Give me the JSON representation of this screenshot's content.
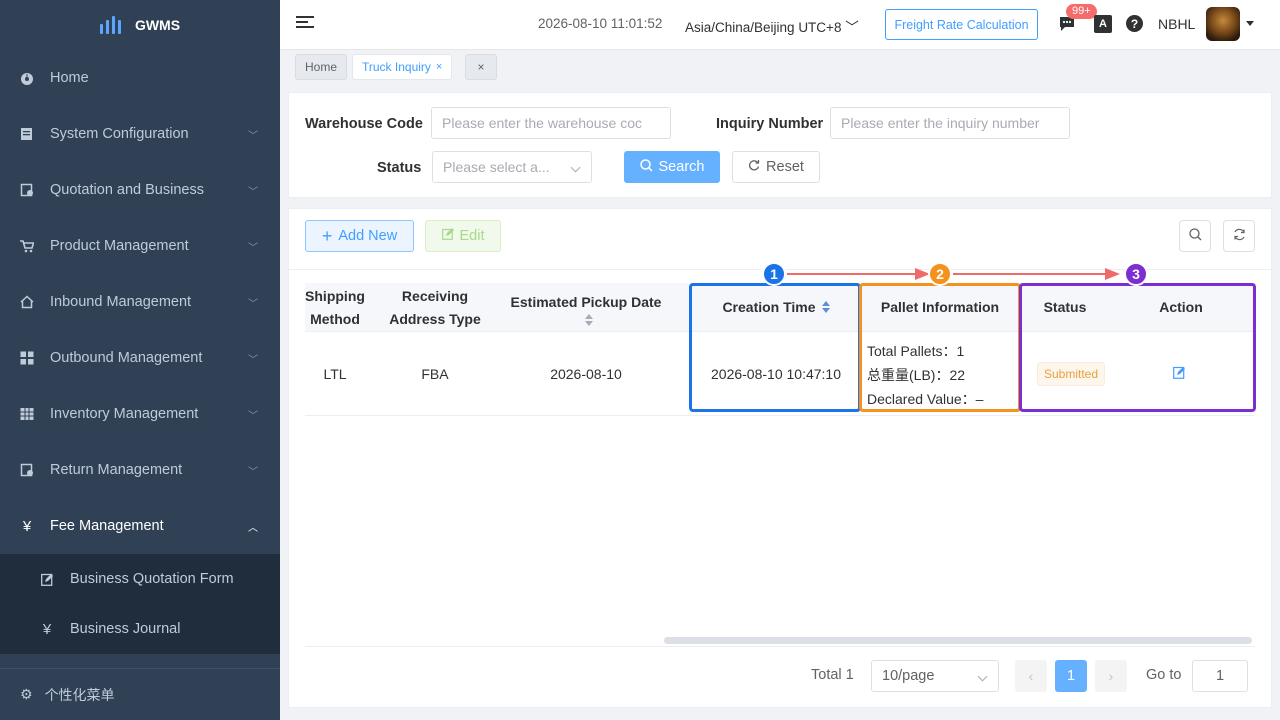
{
  "app": {
    "name": "GWMS"
  },
  "sidebar": {
    "items": [
      {
        "label": "Home",
        "icon": "dashboard-icon"
      },
      {
        "label": "System Configuration",
        "icon": "settings-doc-icon"
      },
      {
        "label": "Quotation and Business",
        "icon": "quotation-icon"
      },
      {
        "label": "Product Management",
        "icon": "cart-icon"
      },
      {
        "label": "Inbound Management",
        "icon": "house-icon"
      },
      {
        "label": "Outbound Management",
        "icon": "grid-icon"
      },
      {
        "label": "Inventory Management",
        "icon": "table-icon"
      },
      {
        "label": "Return Management",
        "icon": "return-icon"
      },
      {
        "label": "Fee Management",
        "icon": "yen-icon"
      }
    ],
    "submenu": [
      {
        "label": "Business Quotation Form",
        "icon": "edit-doc-icon"
      },
      {
        "label": "Business Journal",
        "icon": "yen-icon"
      }
    ],
    "footer": "个性化菜单"
  },
  "header": {
    "datetime": "2026-08-10 11:01:52",
    "timezone": "Asia/China/Beijing UTC+8",
    "freight_button": "Freight Rate Calculation",
    "badge": "99+",
    "lang": "A",
    "help": "?",
    "user": "NBHL"
  },
  "tabs": [
    {
      "label": "Home"
    },
    {
      "label": "Truck Inquiry",
      "close": "×"
    },
    {
      "label": "×"
    }
  ],
  "search": {
    "warehouse_label": "Warehouse Code",
    "warehouse_placeholder": "Please enter the warehouse coc",
    "inquiry_label": "Inquiry Number",
    "inquiry_placeholder": "Please enter the inquiry number",
    "status_label": "Status",
    "status_placeholder": "Please select a...",
    "search_btn": "Search",
    "reset_btn": "Reset"
  },
  "toolbar": {
    "add": "Add New",
    "edit": "Edit"
  },
  "table": {
    "headers": {
      "shipping_1": "Shipping",
      "shipping_2": "Method",
      "receiving_1": "Receiving",
      "receiving_2": "Address Type",
      "pickup": "Estimated Pickup Date",
      "creation": "Creation Time",
      "pallet": "Pallet Information",
      "status": "Status",
      "action": "Action"
    },
    "row": {
      "shipping": "LTL",
      "receiving": "FBA",
      "pickup": "2026-08-10",
      "creation": "2026-08-10 10:47:10",
      "pallets": "Total Pallets：1",
      "weight": "总重量(LB)：22",
      "declared": "Declared Value：–",
      "status": "Submitted"
    }
  },
  "annotations": [
    {
      "num": "1",
      "color": "#1a73e8"
    },
    {
      "num": "2",
      "color": "#f5921e"
    },
    {
      "num": "3",
      "color": "#7b2fd1"
    }
  ],
  "pagination": {
    "total": "Total 1",
    "page_size": "10/page",
    "current": "1",
    "goto_label": "Go to",
    "goto_value": "1",
    "prev": "‹",
    "next": "›"
  }
}
